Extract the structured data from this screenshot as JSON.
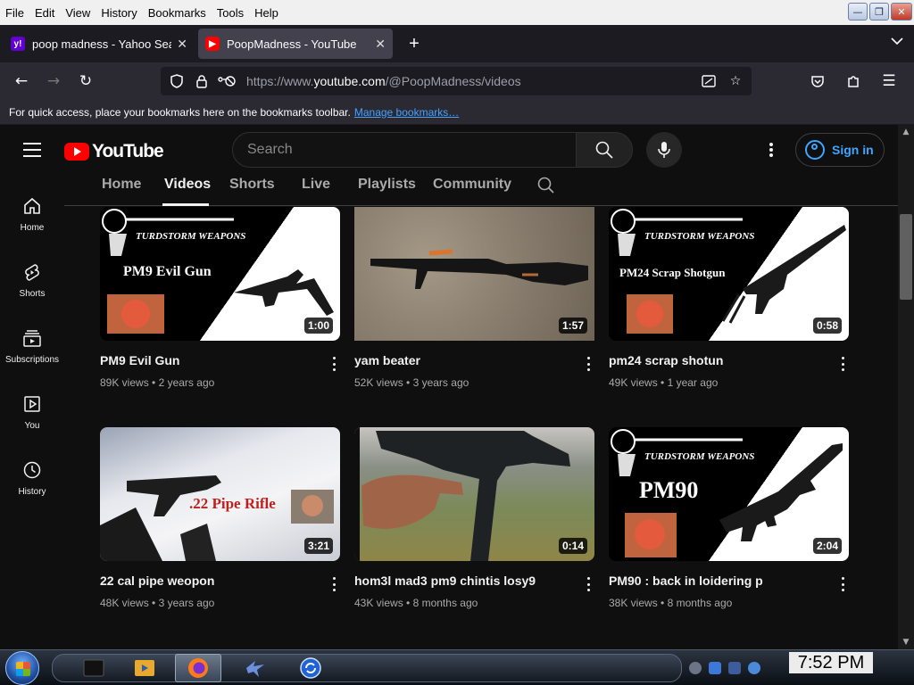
{
  "menubar": {
    "items": [
      "File",
      "Edit",
      "View",
      "History",
      "Bookmarks",
      "Tools",
      "Help"
    ]
  },
  "tabs": [
    {
      "title": "poop madness - Yahoo Search",
      "active": false
    },
    {
      "title": "PoopMadness - YouTube",
      "active": true
    }
  ],
  "nav": {
    "url_prefix": "https://www.",
    "url_host": "youtube.com",
    "url_path": "/@PoopMadness/videos"
  },
  "bookmarks_bar": {
    "text": "For quick access, place your bookmarks here on the bookmarks toolbar.",
    "link": "Manage bookmarks…"
  },
  "masthead": {
    "logo_text": "YouTube",
    "search_placeholder": "Search",
    "sign_in": "Sign in"
  },
  "guide": [
    {
      "label": "Home",
      "icon": "home-icon"
    },
    {
      "label": "Shorts",
      "icon": "shorts-icon"
    },
    {
      "label": "Subscriptions",
      "icon": "subscriptions-icon"
    },
    {
      "label": "You",
      "icon": "you-icon"
    },
    {
      "label": "History",
      "icon": "history-icon"
    }
  ],
  "channel_tabs": [
    "Home",
    "Videos",
    "Shorts",
    "Live",
    "Playlists",
    "Community"
  ],
  "selected_tab": "Videos",
  "videos": [
    {
      "title": "PM9 Evil Gun",
      "views": "89K views",
      "age": "2 years ago",
      "duration": "1:00",
      "thumb_text": "PM9 Evil Gun"
    },
    {
      "title": "yam beater",
      "views": "52K views",
      "age": "3 years ago",
      "duration": "1:57",
      "thumb_text": ""
    },
    {
      "title": "pm24 scrap shotun",
      "views": "49K views",
      "age": "1 year ago",
      "duration": "0:58",
      "thumb_text": "PM24 Scrap Shotgun"
    },
    {
      "title": "22 cal pipe weopon",
      "views": "48K views",
      "age": "3 years ago",
      "duration": "3:21",
      "thumb_text": ".22 Pipe Rifle"
    },
    {
      "title": "hom3l mad3 pm9 chintis losy9",
      "views": "43K views",
      "age": "8 months ago",
      "duration": "0:14",
      "thumb_text": ""
    },
    {
      "title": "PM90 : back in loidering p",
      "views": "38K views",
      "age": "8 months ago",
      "duration": "2:04",
      "thumb_text": "PM90"
    }
  ],
  "taskbar": {
    "clock": "7:52 PM"
  },
  "colors": {
    "yt_red": "#ff0000",
    "link_blue": "#3ea6ff",
    "page_bg": "#0f0f0f"
  }
}
